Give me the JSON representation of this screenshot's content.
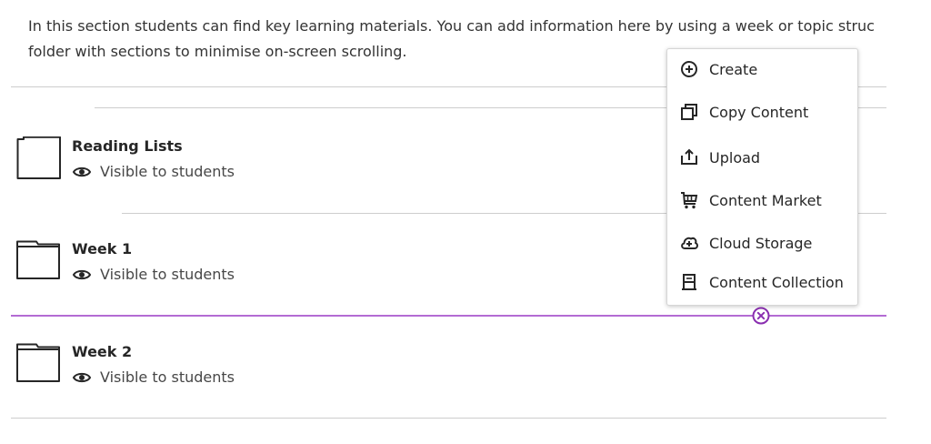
{
  "intro": {
    "line1": "In this section students can find key learning materials. You can add information here by using a week or topic struc",
    "line2": "folder with sections to minimise on-screen scrolling."
  },
  "items": [
    {
      "title": "Reading Lists",
      "visibility": "Visible to students",
      "icon": "page-icon"
    },
    {
      "title": "Week 1",
      "visibility": "Visible to students",
      "icon": "folder-icon"
    },
    {
      "title": "Week 2",
      "visibility": "Visible to students",
      "icon": "folder-icon"
    }
  ],
  "menu": {
    "items": [
      {
        "label": "Create",
        "icon": "plus-circle-icon"
      },
      {
        "label": "Copy Content",
        "icon": "copy-icon"
      },
      {
        "label": "Upload",
        "icon": "upload-icon"
      },
      {
        "label": "Content Market",
        "icon": "cart-icon"
      },
      {
        "label": "Cloud Storage",
        "icon": "cloud-icon"
      },
      {
        "label": "Content Collection",
        "icon": "collection-icon"
      }
    ]
  },
  "colors": {
    "insertion_line": "#b36bd3",
    "divider": "#cdcdcd",
    "text": "#262626"
  }
}
